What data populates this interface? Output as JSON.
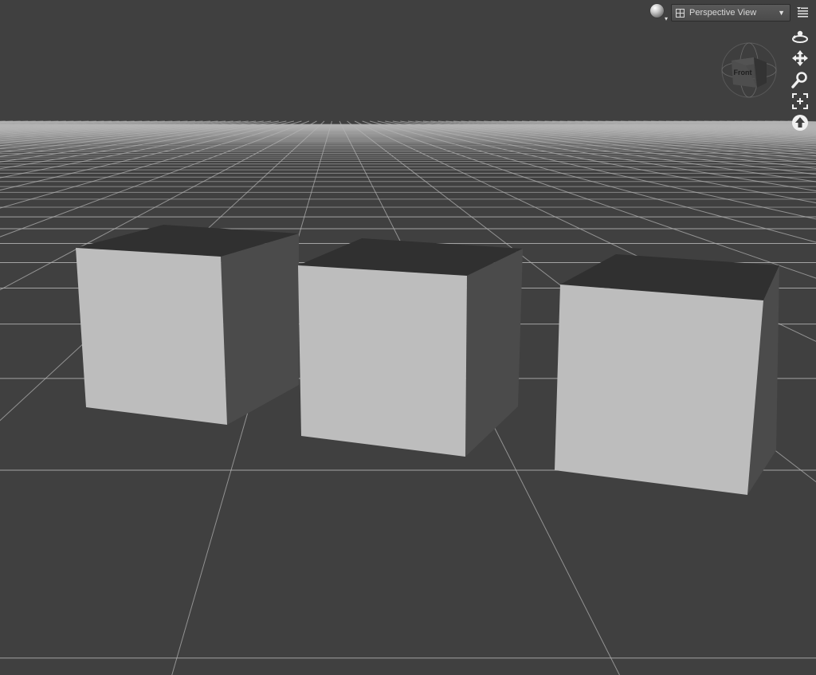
{
  "viewport": {
    "background": "#404040",
    "grid_color": "#b8b8b8"
  },
  "toolbar": {
    "environment_icon": "sphere-preview-icon",
    "view_select": {
      "selected": "Perspective View",
      "icon": "viewport-layout-icon"
    },
    "menu_icon": "viewport-menu-icon"
  },
  "nav_cube": {
    "face_label": "Front"
  },
  "nav_tools": [
    {
      "name": "orbit-icon"
    },
    {
      "name": "pan-icon"
    },
    {
      "name": "zoom-icon"
    },
    {
      "name": "frame-icon"
    },
    {
      "name": "up-arrow-icon"
    }
  ],
  "scene": {
    "objects": [
      {
        "name": "cube-1",
        "front_color": "#bcbcbc",
        "side_color": "#4a4a4a",
        "top_color": "#303030"
      },
      {
        "name": "cube-2",
        "front_color": "#bcbcbc",
        "side_color": "#4a4a4a",
        "top_color": "#303030"
      },
      {
        "name": "cube-3",
        "front_color": "#bcbcbc",
        "side_color": "#4a4a4a",
        "top_color": "#303030"
      }
    ]
  }
}
